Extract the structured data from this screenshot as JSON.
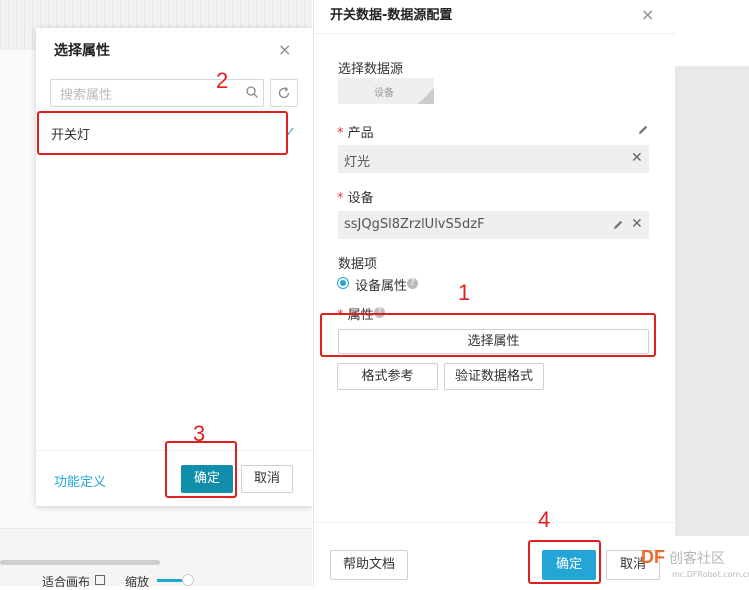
{
  "left_modal": {
    "title": "选择属性",
    "close": "×",
    "search_placeholder": "搜索属性",
    "items": [
      {
        "label": "开关灯",
        "selected": true
      }
    ],
    "function_link": "功能定义",
    "ok": "确定",
    "cancel": "取消"
  },
  "right_panel": {
    "title": "开关数据-数据源配置",
    "close": "×",
    "source_label": "选择数据源",
    "source_button": "设备",
    "product_label": "产品",
    "product_value": "灯光",
    "device_label": "设备",
    "device_value": "ssJQgSl8ZrzlUlvS5dzF",
    "data_item_label": "数据项",
    "radio_label": "设备属性",
    "property_label": "属性",
    "select_property": "选择属性",
    "format_ref": "格式参考",
    "verify_format": "验证数据格式",
    "help_doc": "帮助文档",
    "ok": "确定",
    "cancel": "取消"
  },
  "canvas_toolbar": {
    "fit_label": "适合画布",
    "zoom_label": "缩放"
  },
  "annotations": [
    "1",
    "2",
    "3",
    "4"
  ],
  "watermark": {
    "brand": "DF",
    "text": "创客社区",
    "url": "mc.DFRobot.com.cn"
  },
  "colors": {
    "accent": "#23a6d5",
    "ok_dark": "#118eab",
    "annotation": "#e02020"
  }
}
